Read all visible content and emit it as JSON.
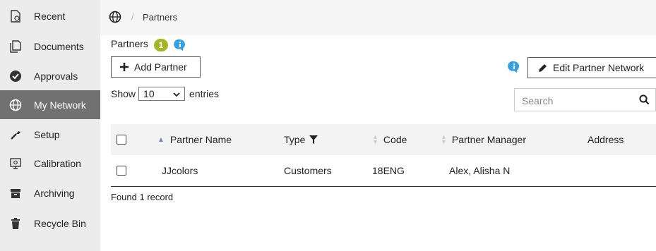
{
  "sidebar": {
    "items": [
      {
        "label": "Recent",
        "icon": "recent-file-icon"
      },
      {
        "label": "Documents",
        "icon": "documents-icon"
      },
      {
        "label": "Approvals",
        "icon": "check-circle-icon"
      },
      {
        "label": "My Network",
        "icon": "globe-icon",
        "active": true
      },
      {
        "label": "Setup",
        "icon": "wrench-icon"
      },
      {
        "label": "Calibration",
        "icon": "calibration-icon"
      },
      {
        "label": "Archiving",
        "icon": "archive-icon"
      },
      {
        "label": "Recycle Bin",
        "icon": "trash-icon"
      }
    ]
  },
  "breadcrumb": {
    "separator": "/",
    "current": "Partners"
  },
  "header": {
    "title": "Partners",
    "count": "1"
  },
  "toolbar": {
    "add_label": "Add Partner",
    "edit_label": "Edit Partner Network"
  },
  "length_menu": {
    "prefix": "Show",
    "value": "10",
    "suffix": "entries"
  },
  "search": {
    "placeholder": "Search"
  },
  "table": {
    "columns": [
      "Partner Name",
      "Type",
      "Code",
      "Partner Manager",
      "Address"
    ],
    "rows": [
      {
        "name": "JJcolors",
        "type": "Customers",
        "code": "18ENG",
        "manager": "Alex, Alisha N",
        "address": ""
      }
    ]
  },
  "footer": {
    "text": "Found 1 record"
  },
  "colors": {
    "active_nav": "#717171",
    "badge": "#a6b52a",
    "info": "#3aa0dc"
  }
}
